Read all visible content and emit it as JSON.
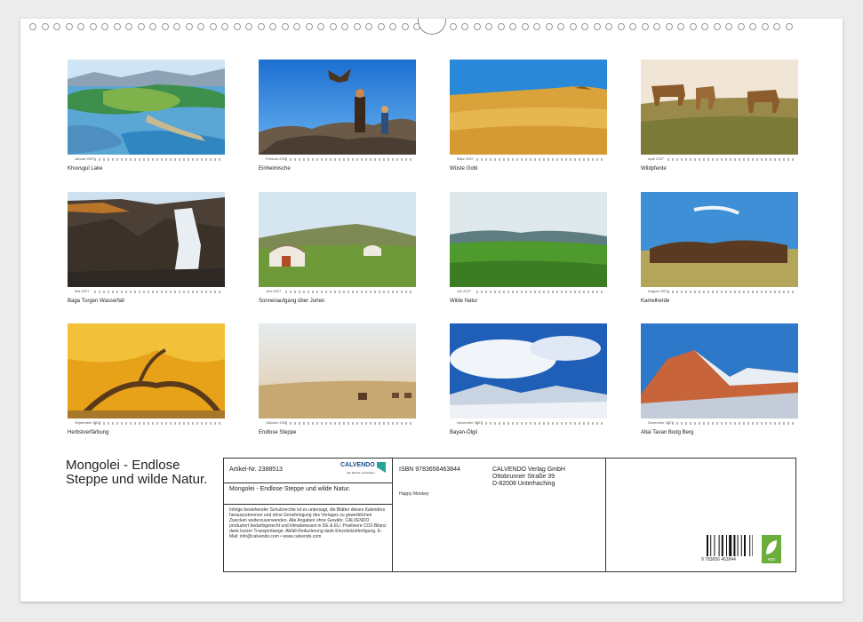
{
  "calendar": {
    "months": [
      {
        "name": "Januar 2027",
        "caption": "Khuvsgul Lake"
      },
      {
        "name": "Februar 2027",
        "caption": "Einheimische"
      },
      {
        "name": "März 2027",
        "caption": "Wüste Gobi"
      },
      {
        "name": "April 2027",
        "caption": "Wildpferde"
      },
      {
        "name": "Mai 2027",
        "caption": "Baga Turgen Wasserfall"
      },
      {
        "name": "Juni 2027",
        "caption": "Sonnenaufgang über Jurten"
      },
      {
        "name": "Juli 2027",
        "caption": "Wilde Natur"
      },
      {
        "name": "August 2027",
        "caption": "Kamelherde"
      },
      {
        "name": "September 2027",
        "caption": "Herbstverfärbung"
      },
      {
        "name": "Oktober 2027",
        "caption": "Endlose Steppe"
      },
      {
        "name": "November 2027",
        "caption": "Bayan-Ölgii"
      },
      {
        "name": "Dezember 2027",
        "caption": "Altai Tavan Bodg Berg"
      }
    ]
  },
  "title": "Mongolei - Endlose Steppe und wilde Natur.",
  "info": {
    "article": "Artikel-Nr. 2388513",
    "brand": "CALVENDO",
    "brand_sub": "Alle Rechte vorbehalten",
    "product_title": "Mongolei - Endlose Steppe und wilde Natur.",
    "legal_text": "Infolge bestehender Schutzrechte ist es untersagt, die Blätter dieses Kalenders herauszutrennen und ohne Genehmigung des Verlages zu gewerblichen Zwecken weiterzuverwenden. Alle Angaben ohne Gewähr. CALVENDO produziert bedarfsgerecht und klimabewusst in DE & EU. Positivere CO2-Bilanz dank kurzer Transportwege. Abfall-Reduzierung dank Einzelstückfertigung. E-Mail: info@calvendo.com • www.calvendo.com",
    "isbn": "ISBN 9783656463844",
    "publisher_name": "CALVENDO Verlag GmbH",
    "publisher_street": "Ottobrunner Straße 39",
    "publisher_city": "D-82008 Unterhaching",
    "author": "Happy Monkey",
    "barcode_number": "9 783656 463844"
  }
}
